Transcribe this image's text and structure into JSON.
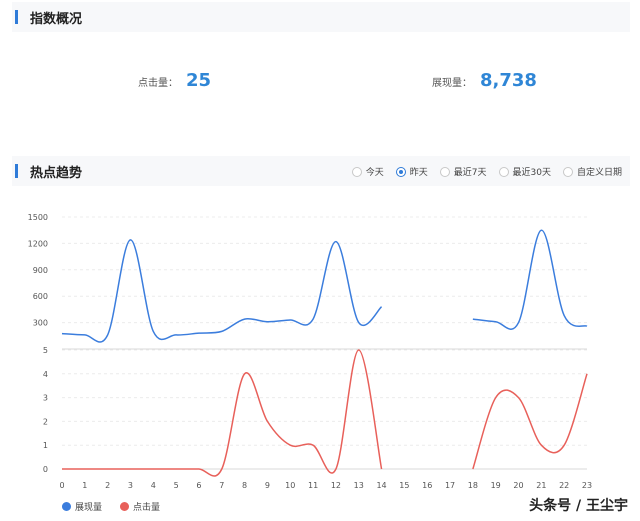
{
  "index_section": {
    "title": "指数概况"
  },
  "stats": {
    "clicks": {
      "label": "点击量：",
      "value": "25"
    },
    "impressions": {
      "label": "展现量：",
      "value": "8,738"
    }
  },
  "trend_section": {
    "title": "热点趋势",
    "ranges": [
      {
        "label": "今天",
        "selected": false
      },
      {
        "label": "昨天",
        "selected": true
      },
      {
        "label": "最近7天",
        "selected": false
      },
      {
        "label": "最近30天",
        "selected": false
      },
      {
        "label": "自定义日期",
        "selected": false
      }
    ]
  },
  "colors": {
    "accent": "#2f7bd8",
    "impressions": "#3b7ddd",
    "clicks": "#e8605a"
  },
  "chart_data": [
    {
      "type": "line",
      "x": [
        0,
        1,
        2,
        3,
        4,
        5,
        6,
        7,
        8,
        9,
        10,
        11,
        12,
        13,
        14,
        15,
        16,
        17,
        18,
        19,
        20,
        21,
        22,
        23
      ],
      "ylim": [
        0,
        1500
      ],
      "yticks": [
        300,
        600,
        900,
        1200,
        1500
      ],
      "series": [
        {
          "name": "展现量",
          "values": [
            175,
            160,
            160,
            1240,
            200,
            160,
            180,
            200,
            340,
            310,
            330,
            340,
            1220,
            300,
            480,
            null,
            null,
            null,
            340,
            310,
            300,
            1350,
            380,
            260
          ]
        }
      ]
    },
    {
      "type": "line",
      "x": [
        0,
        1,
        2,
        3,
        4,
        5,
        6,
        7,
        8,
        9,
        10,
        11,
        12,
        13,
        14,
        15,
        16,
        17,
        18,
        19,
        20,
        21,
        22,
        23
      ],
      "ylim": [
        0,
        5
      ],
      "yticks": [
        0,
        1,
        2,
        3,
        4,
        5
      ],
      "series": [
        {
          "name": "点击量",
          "values": [
            0,
            0,
            0,
            0,
            0,
            0,
            0,
            0,
            4,
            2,
            1,
            1,
            0,
            5,
            0,
            null,
            null,
            null,
            0,
            3,
            3,
            1,
            1,
            4
          ]
        }
      ]
    }
  ]
}
